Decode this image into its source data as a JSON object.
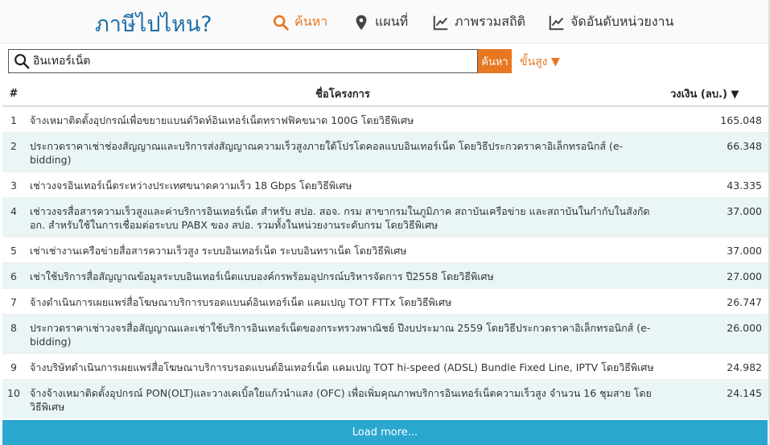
{
  "header": {
    "logo": "ภาษีไปไหน?",
    "nav": [
      {
        "label": "ค้นหา",
        "icon": "search-icon"
      },
      {
        "label": "แผนที่",
        "icon": "map-pin-icon"
      },
      {
        "label": "ภาพรวมสถิติ",
        "icon": "line-chart-icon"
      },
      {
        "label": "จัดอันดับหน่วยงาน",
        "icon": "line-chart-icon"
      }
    ],
    "accent_color": "#e87722",
    "logo_color": "#1f6fa8"
  },
  "search": {
    "value": "อินเทอร์เน็ต",
    "button_label": "ค้นหา",
    "sort_label": "ขั้นสูง ▼"
  },
  "table": {
    "columns": [
      "#",
      "ชื่อโครงการ",
      "วงเงิน (ลบ.) ▼"
    ],
    "rows": [
      {
        "num": "1",
        "name": "จ้างเหมาติดตั้งอุปกรณ์เพื่อขยายแบนด์วิดท์อินเทอร์เน็ตทราฟฟิคขนาด 100G โดยวิธีพิเศษ",
        "amount": "165.048"
      },
      {
        "num": "2",
        "name": "ประกวดราคาเช่าช่องสัญญาณและบริการส่งสัญญาณความเร็วสูงภายใต้โปรโตคอลแบบอินเทอร์เน็ต โดยวิธีประกวดราคาอิเล็กทรอนิกส์ (e-bidding)",
        "amount": "66.348"
      },
      {
        "num": "3",
        "name": "เช่าวงจรอินเทอร์เน็ตระหว่างประเทศขนาดความเร็ว 18 Gbps โดยวิธีพิเศษ",
        "amount": "43.335"
      },
      {
        "num": "4",
        "name": "เช่าวงจรสื่อสารความเร็วสูงและค่าบริการอินเทอร์เน็ต สำหรับ สปอ. สอจ. กรม สาขากรมในภูมิภาค สถาบันเครือข่าย และสถาบันในกำกับในสังกัด อก. สำหรับใช้ในการเชื่อมต่อระบบ PABX ของ สปอ. รวมทั้งในหน่วยงานระดับกรม โดยวิธีพิเศษ",
        "amount": "37.000"
      },
      {
        "num": "5",
        "name": "เช่าเช่างานเครือข่ายสื่อสารความเร็วสูง ระบบอินเทอร์เน็ต ระบบอินทราเน็ต โดยวิธีพิเศษ",
        "amount": "37.000"
      },
      {
        "num": "6",
        "name": "เช่าใช้บริการสื่อสัญญาณข้อมูลระบบอินเทอร์เน็ตแบบองค์กรพร้อมอุปกรณ์บริหารจัดการ ปี2558 โดยวิธีพิเศษ",
        "amount": "27.000"
      },
      {
        "num": "7",
        "name": "จ้างดำเนินการเผยแพร่สื่อโฆษณาบริการบรอดแบนด์อินเทอร์เน็ต แคมเปญ TOT FTTx โดยวิธีพิเศษ",
        "amount": "26.747"
      },
      {
        "num": "8",
        "name": "ประกวดราคาเช่าวงจรสื่อสัญญาณและเช่าใช้บริการอินเทอร์เน็ตของกระทรวงพาณิชย์ ปีงบประมาณ 2559 โดยวิธีประกวดราคาอิเล็กทรอนิกส์ (e-bidding)",
        "amount": "26.000"
      },
      {
        "num": "9",
        "name": "จ้างบริษัทดำเนินการเผยแพร่สื่อโฆษณาบริการบรอดแบนด์อินเทอร์เน็ต แคมเปญ TOT hi-speed (ADSL) Bundle Fixed Line, IPTV โดยวิธีพิเศษ",
        "amount": "24.982"
      },
      {
        "num": "10",
        "name": "จ้างจ้างเหมาติดตั้งอุปกรณ์ PON(OLT)และวางเคเบิ้ลใยแก้วนำแสง (OFC) เพื่อเพิ่มคุณภาพบริการอินเทอร์เน็ตความเร็วสูง จำนวน 16 ชุมสาย โดยวิธีพิเศษ",
        "amount": "24.145"
      }
    ]
  },
  "load_more": "Load more...",
  "row_stripe_color": "#eaf5f5",
  "load_more_color": "#2aa7cf"
}
